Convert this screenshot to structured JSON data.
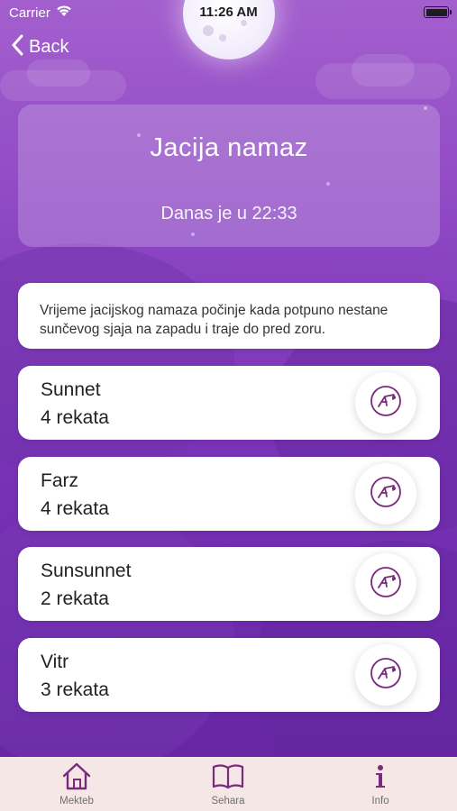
{
  "status_bar": {
    "carrier": "Carrier",
    "time": "11:26 AM"
  },
  "nav": {
    "back_label": "Back"
  },
  "header": {
    "title": "Jacija namaz",
    "subtitle": "Danas je u 22:33"
  },
  "info": {
    "text": "Vrijeme jacijskog namaza počinje kada potpuno nestane sunčevog sjaja na zapadu i traje do pred zoru."
  },
  "rakats": [
    {
      "name": "Sunnet",
      "count": "4 rekata",
      "icon": "prayer-posture-icon"
    },
    {
      "name": "Farz",
      "count": "4 rekata",
      "icon": "prayer-posture-icon"
    },
    {
      "name": "Sunsunnet",
      "count": "2 rekata",
      "icon": "prayer-posture-icon"
    },
    {
      "name": "Vitr",
      "count": "3 rekata",
      "icon": "prayer-posture-icon"
    }
  ],
  "tab_bar": {
    "items": [
      {
        "label": "Mekteb",
        "icon": "home-icon"
      },
      {
        "label": "Sehara",
        "icon": "book-icon"
      },
      {
        "label": "Info",
        "icon": "info-icon"
      }
    ]
  },
  "colors": {
    "background_top": "#a45fce",
    "background_bottom": "#65249f",
    "accent": "#7a2a7e",
    "tab_bar": "#f4e7e6"
  }
}
